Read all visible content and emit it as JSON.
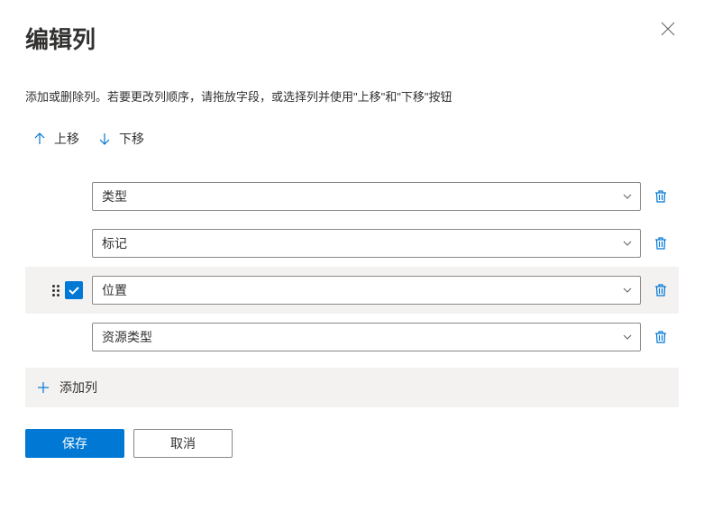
{
  "header": {
    "title": "编辑列"
  },
  "description": "添加或删除列。若要更改列顺序，请拖放字段，或选择列并使用\"上移\"和\"下移\"按钮",
  "move": {
    "up_label": "上移",
    "down_label": "下移"
  },
  "columns": [
    {
      "label": "类型",
      "selected": false
    },
    {
      "label": "标记",
      "selected": false
    },
    {
      "label": "位置",
      "selected": true
    },
    {
      "label": "资源类型",
      "selected": false
    }
  ],
  "add_column_label": "添加列",
  "footer": {
    "save_label": "保存",
    "cancel_label": "取消"
  }
}
